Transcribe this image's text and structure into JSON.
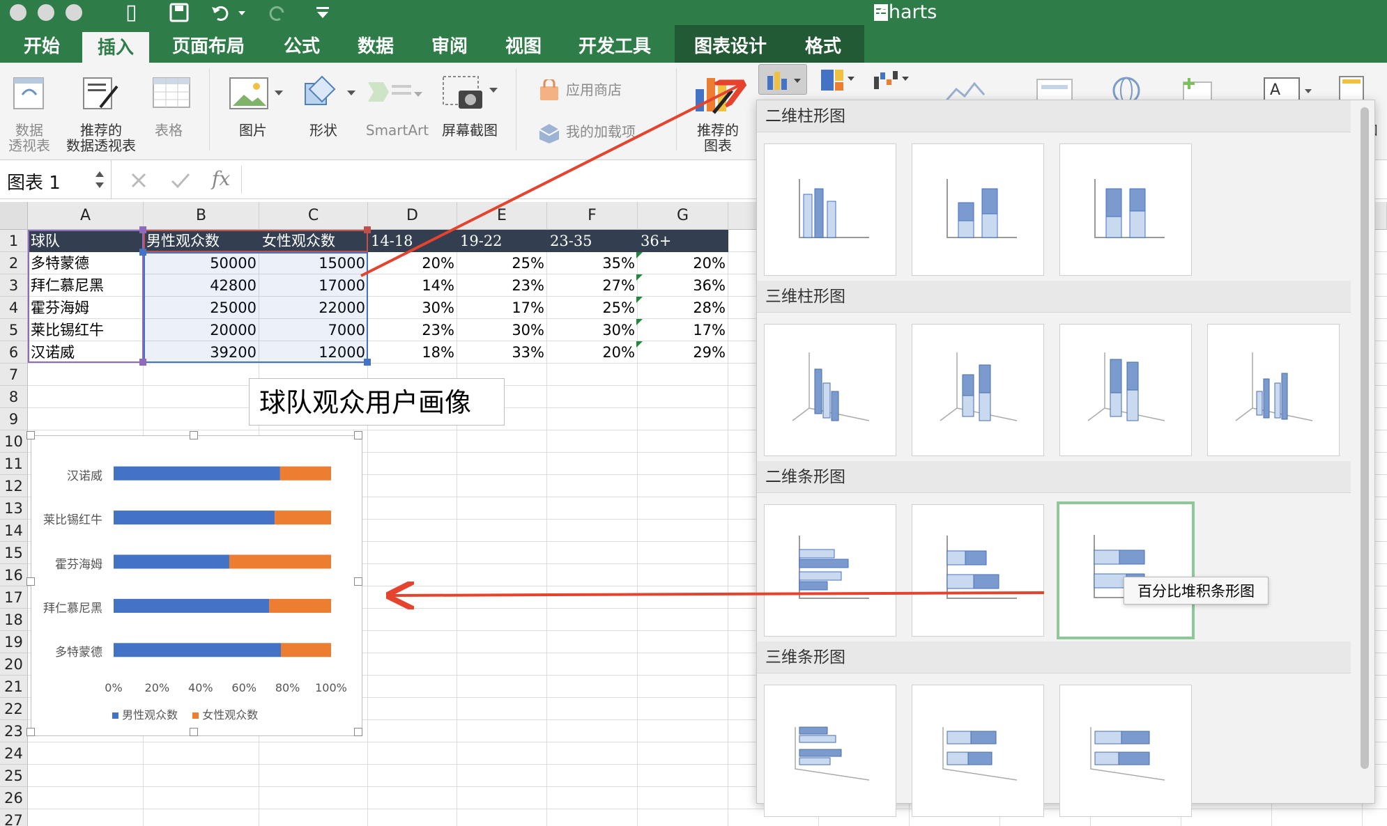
{
  "window": {
    "title": "charts"
  },
  "tabs": [
    "开始",
    "插入",
    "页面布局",
    "公式",
    "数据",
    "审阅",
    "视图",
    "开发工具",
    "图表设计",
    "格式"
  ],
  "ribbon": {
    "pivot": [
      "数据",
      "透视表"
    ],
    "rec_pivot": [
      "推荐的",
      "数据透视表"
    ],
    "table": "表格",
    "picture": "图片",
    "shapes": "形状",
    "smartart": "SmartArt",
    "screenshot": "屏幕截图",
    "store": "应用商店",
    "addins": "我的加载项",
    "rec_chart": [
      "推荐的",
      "图表"
    ],
    "cut_label": "和"
  },
  "formula": {
    "name_box": "图表 1",
    "fx": "fx"
  },
  "columns": [
    "A",
    "B",
    "C",
    "D",
    "E",
    "F",
    "G"
  ],
  "rows": [
    "1",
    "2",
    "3",
    "4",
    "5",
    "6",
    "7",
    "8",
    "9",
    "10",
    "11",
    "12",
    "13",
    "14",
    "15",
    "16",
    "17",
    "18",
    "19",
    "20",
    "21",
    "22",
    "23",
    "24",
    "25",
    "26",
    "27"
  ],
  "table": {
    "header": [
      "球队",
      "男性观众数",
      "女性观众数",
      "14-18",
      "19-22",
      "23-35",
      "36+"
    ],
    "data": [
      [
        "多特蒙德",
        "50000",
        "15000",
        "20%",
        "25%",
        "35%",
        "20%"
      ],
      [
        "拜仁慕尼黑",
        "42800",
        "17000",
        "14%",
        "23%",
        "27%",
        "36%"
      ],
      [
        "霍芬海姆",
        "25000",
        "22000",
        "30%",
        "17%",
        "25%",
        "28%"
      ],
      [
        "莱比锡红牛",
        "20000",
        "7000",
        "23%",
        "30%",
        "30%",
        "17%"
      ],
      [
        "汉诺威",
        "39200",
        "12000",
        "18%",
        "33%",
        "20%",
        "29%"
      ]
    ]
  },
  "chart_title": "球队观众用户画像",
  "chart_data": {
    "type": "bar",
    "orientation": "horizontal",
    "stacking": "percent",
    "categories": [
      "汉诺威",
      "莱比锡红牛",
      "霍芬海姆",
      "拜仁慕尼黑",
      "多特蒙德"
    ],
    "series": [
      {
        "name": "男性观众数",
        "values": [
          39200,
          20000,
          25000,
          42800,
          50000
        ]
      },
      {
        "name": "女性观众数",
        "values": [
          12000,
          7000,
          22000,
          17000,
          15000
        ]
      }
    ],
    "xlim": [
      0,
      100
    ],
    "x_ticks": [
      "0%",
      "20%",
      "40%",
      "60%",
      "80%",
      "100%"
    ],
    "legend": "bottom",
    "colors": [
      "#4472c4",
      "#ed7d31"
    ]
  },
  "gallery": {
    "sections": [
      "二维柱形图",
      "三维柱形图",
      "二维条形图",
      "三维条形图"
    ],
    "tooltip": "百分比堆积条形图"
  },
  "colors": {
    "ribbon_green": "#2e7d48",
    "header_dark": "#333f50",
    "selection": "#4472c4",
    "arrow": "#e5432d"
  }
}
